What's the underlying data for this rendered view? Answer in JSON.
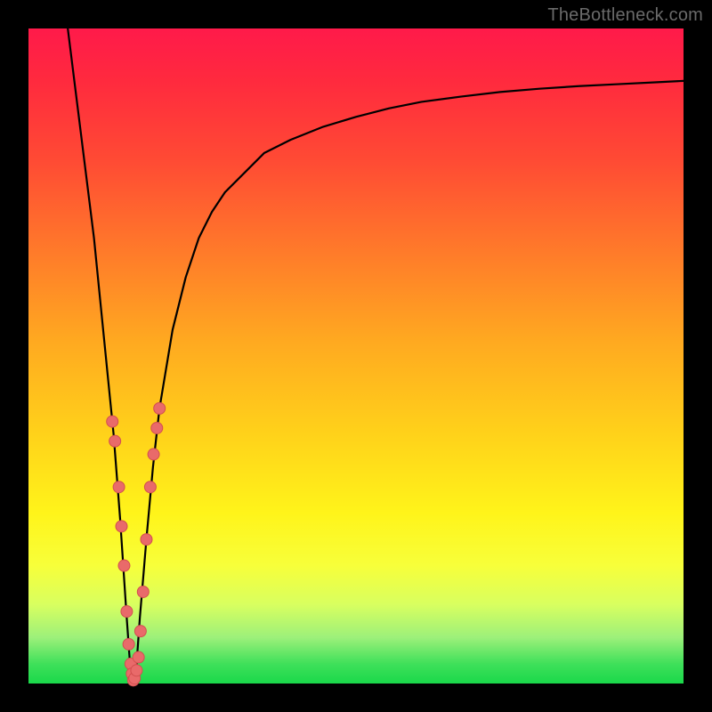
{
  "watermark": "TheBottleneck.com",
  "colors": {
    "curve_stroke": "#000000",
    "point_fill": "#e96a6a",
    "point_stroke": "#d24f4f"
  },
  "chart_data": {
    "type": "line",
    "title": "",
    "xlabel": "",
    "ylabel": "",
    "xlim": [
      0,
      100
    ],
    "ylim": [
      0,
      100
    ],
    "grid": false,
    "legend": false,
    "series": [
      {
        "name": "bottleneck-curve",
        "x": [
          6,
          7,
          8,
          9,
          10,
          11,
          12,
          13,
          14,
          15,
          15.5,
          16,
          16.5,
          17,
          18,
          19,
          20,
          22,
          24,
          26,
          28,
          30,
          33,
          36,
          40,
          45,
          50,
          55,
          60,
          66,
          72,
          78,
          84,
          90,
          96,
          100
        ],
        "y": [
          100,
          92,
          84,
          76,
          68,
          58,
          48,
          38,
          25,
          10,
          3,
          0,
          3,
          10,
          22,
          33,
          42,
          54,
          62,
          68,
          72,
          75,
          78,
          81,
          83,
          85,
          86.5,
          87.8,
          88.8,
          89.6,
          90.3,
          90.8,
          91.2,
          91.5,
          91.8,
          92
        ]
      }
    ],
    "scatter_points": [
      {
        "x": 12.8,
        "y": 40
      },
      {
        "x": 13.2,
        "y": 37
      },
      {
        "x": 13.8,
        "y": 30
      },
      {
        "x": 14.2,
        "y": 24
      },
      {
        "x": 14.6,
        "y": 18
      },
      {
        "x": 15.0,
        "y": 11
      },
      {
        "x": 15.3,
        "y": 6
      },
      {
        "x": 15.6,
        "y": 3
      },
      {
        "x": 15.8,
        "y": 1.5
      },
      {
        "x": 16.0,
        "y": 0.5
      },
      {
        "x": 16.2,
        "y": 0.8
      },
      {
        "x": 16.5,
        "y": 2
      },
      {
        "x": 16.8,
        "y": 4
      },
      {
        "x": 17.1,
        "y": 8
      },
      {
        "x": 17.5,
        "y": 14
      },
      {
        "x": 18.0,
        "y": 22
      },
      {
        "x": 18.6,
        "y": 30
      },
      {
        "x": 19.1,
        "y": 35
      },
      {
        "x": 19.6,
        "y": 39
      },
      {
        "x": 20.0,
        "y": 42
      }
    ]
  }
}
